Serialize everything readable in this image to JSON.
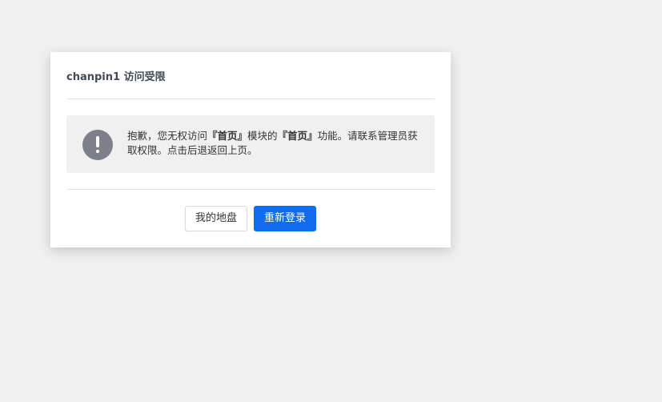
{
  "dialog": {
    "title": "chanpin1 访问受限",
    "icon": "exclamation-circle-icon",
    "message": {
      "part1": "抱歉，您无权访问",
      "module": "『首页』",
      "part2": "模块的",
      "feature": "『首页』",
      "part3": "功能。请联系管理员获取权限。点击后退返回上页。"
    },
    "buttons": {
      "my_disk": "我的地盘",
      "relogin": "重新登录"
    }
  },
  "colors": {
    "primary": "#0f6ced",
    "icon": "#7d8089",
    "background": "#f0f0f0"
  }
}
